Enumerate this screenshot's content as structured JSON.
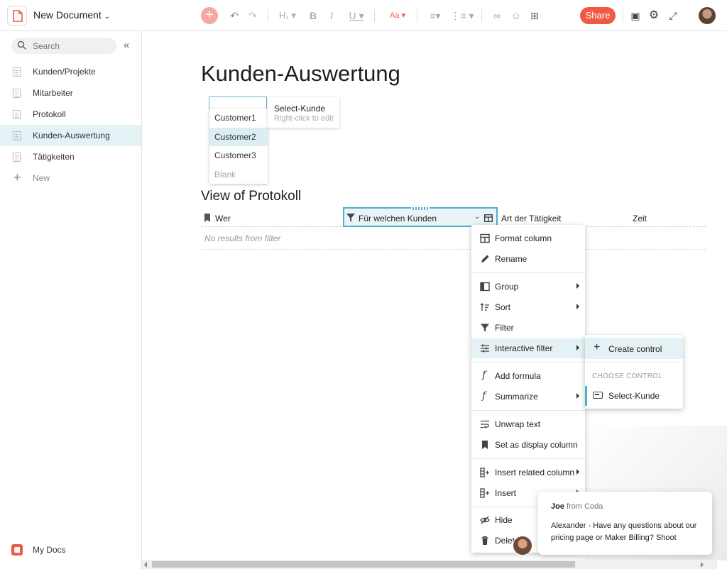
{
  "doc": {
    "title": "New Document"
  },
  "toolbar": {
    "share_label": "Share",
    "accent": "#ee5a45"
  },
  "sidebar": {
    "search_placeholder": "Search",
    "items": [
      {
        "label": "Kunden/Projekte"
      },
      {
        "label": "Mitarbeiter"
      },
      {
        "label": "Protokoll"
      },
      {
        "label": "Kunden-Auswertung",
        "active": true
      },
      {
        "label": "Tätigkeiten"
      }
    ],
    "new_label": "New",
    "mydocs_label": "My Docs"
  },
  "page": {
    "title": "Kunden-Auswertung",
    "control": {
      "tooltip_title": "Select-Kunde",
      "tooltip_hint": "Right-click to edit",
      "options": [
        "Customer1",
        "Customer2",
        "Customer3",
        "Blank"
      ],
      "selected": "Customer2"
    },
    "view": {
      "title": "View of Protokoll",
      "columns": [
        "Wer",
        "Für welchen Kunden",
        "Art der Tätigkeit",
        "Zeit"
      ],
      "empty_text": "No results from filter"
    }
  },
  "context_menu": {
    "items": [
      {
        "label": "Format column",
        "icon": "table-icon"
      },
      {
        "label": "Rename",
        "icon": "pencil-icon"
      },
      {
        "label": "Group",
        "icon": "group-icon",
        "submenu": true
      },
      {
        "label": "Sort",
        "icon": "sort-icon",
        "submenu": true
      },
      {
        "label": "Filter",
        "icon": "filter-icon"
      },
      {
        "label": "Interactive filter",
        "icon": "sliders-icon",
        "submenu": true,
        "highlighted": true
      },
      {
        "label": "Add formula",
        "icon": "formula-icon"
      },
      {
        "label": "Summarize",
        "icon": "formula-icon",
        "submenu": true
      },
      {
        "label": "Unwrap text",
        "icon": "wrap-icon"
      },
      {
        "label": "Set as display column",
        "icon": "bookmark-icon"
      },
      {
        "label": "Insert related column",
        "icon": "insert-column-icon",
        "submenu": true
      },
      {
        "label": "Insert",
        "icon": "insert-column-icon",
        "submenu": true
      },
      {
        "label": "Hide",
        "icon": "eye-off-icon"
      },
      {
        "label": "Delet",
        "icon": "trash-icon"
      }
    ]
  },
  "submenu": {
    "create_label": "Create control",
    "section_heading": "CHOOSE CONTROL",
    "control_item": "Select-Kunde"
  },
  "chat": {
    "sender": "Joe",
    "from_suffix": "from Coda",
    "message": "Alexander -  Have any questions about our pricing page or Maker Billing? Shoot"
  }
}
